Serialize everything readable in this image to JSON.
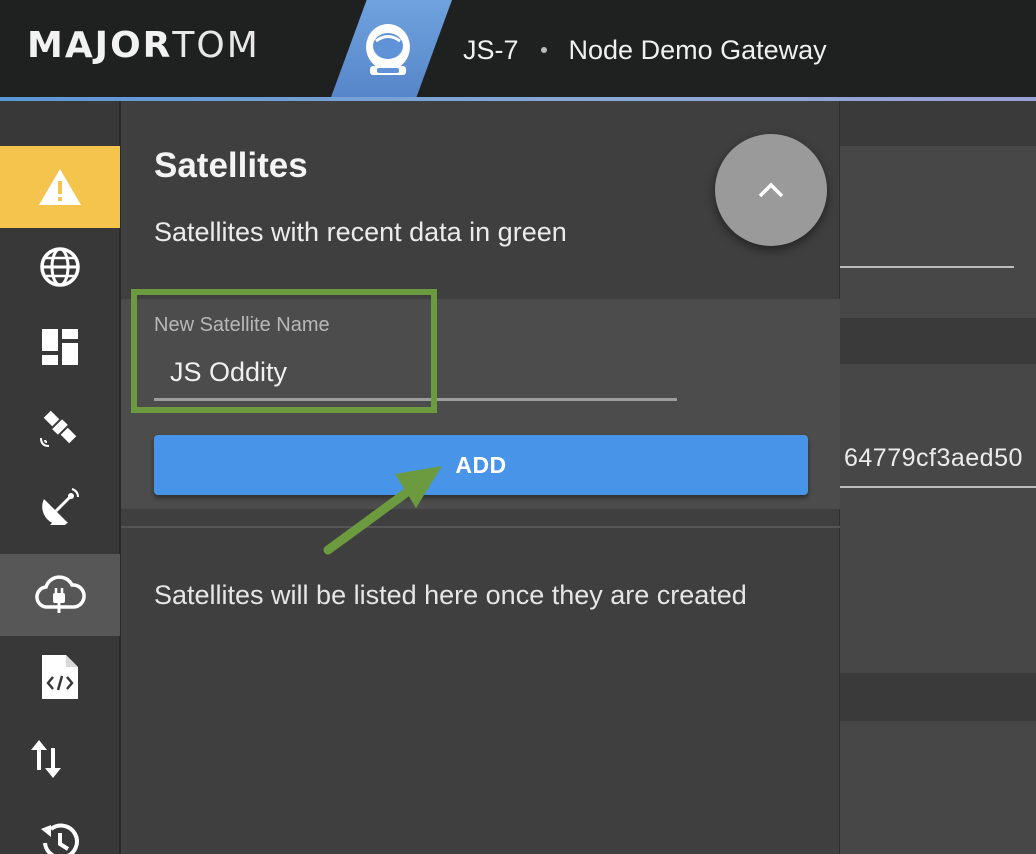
{
  "header": {
    "logo_major": "MAJOR",
    "logo_tom": "TOM",
    "mission": "JS-7",
    "gateway": "Node Demo Gateway"
  },
  "sidebar": {
    "items": [
      {
        "icon": "warning-icon",
        "state": "alert"
      },
      {
        "icon": "globe-icon"
      },
      {
        "icon": "dashboard-icon"
      },
      {
        "icon": "satellite-icon"
      },
      {
        "icon": "ground-station-icon"
      },
      {
        "icon": "cloud-plug-icon",
        "state": "active"
      },
      {
        "icon": "code-file-icon"
      },
      {
        "icon": "transfer-arrows-icon"
      },
      {
        "icon": "history-icon"
      }
    ]
  },
  "satellites_panel": {
    "title": "Satellites",
    "subtitle": "Satellites with recent data in green",
    "new_satellite_label": "New Satellite Name",
    "new_satellite_value": "JS Oddity",
    "add_button_label": "ADD",
    "empty_message": "Satellites will be listed here once they are created"
  },
  "background": {
    "gateway_token_fragment": "64779cf3aed50"
  },
  "colors": {
    "alert": "#f4c44c",
    "primary_button": "#4894e8",
    "highlight": "#6c9a3e",
    "header_accent": "#5a97d6"
  }
}
